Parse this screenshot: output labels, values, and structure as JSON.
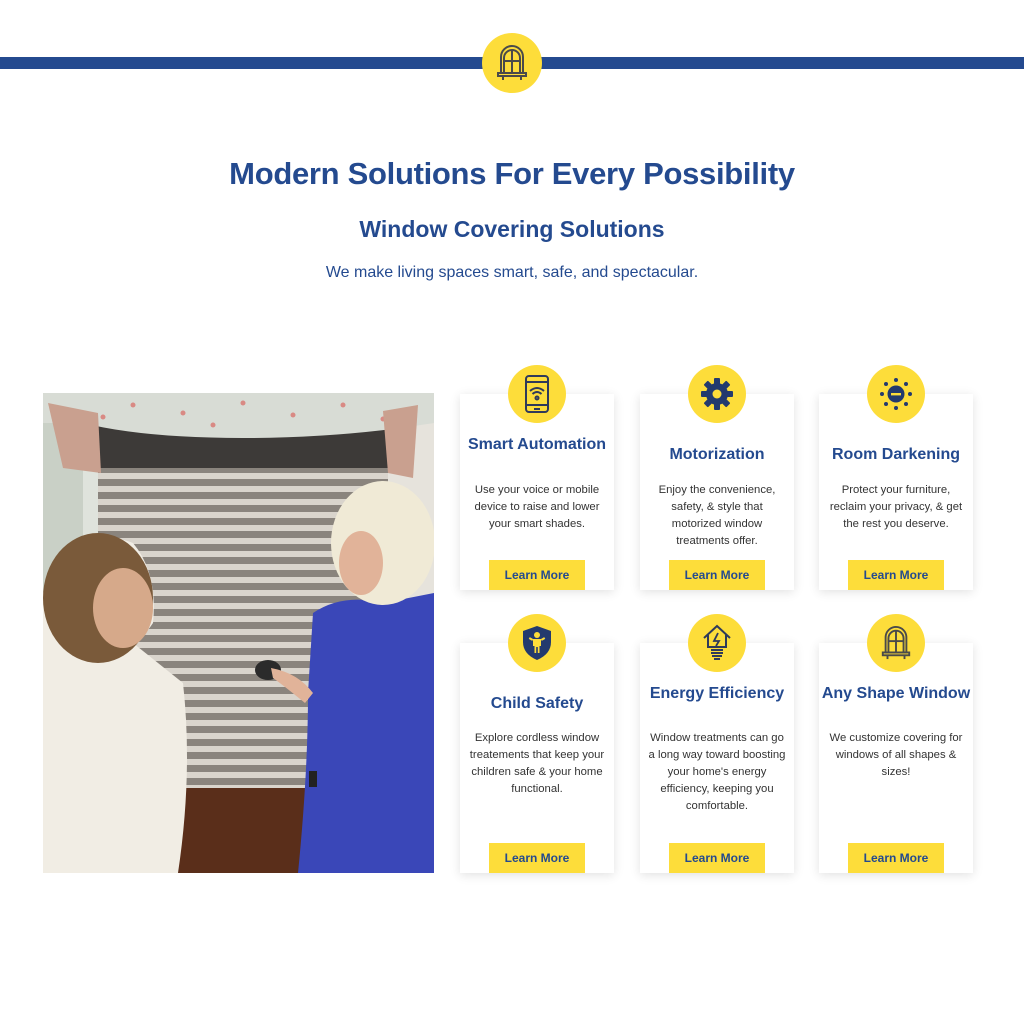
{
  "header": {
    "badge_icon": "arched-window-icon",
    "title": "Modern Solutions For Every Possibility",
    "subtitle": "Window Covering Solutions",
    "tagline": "We make living spaces smart, safe, and spectacular."
  },
  "photo": {
    "alt": "Two women looking at a motorized cellular shade, one holding a remote"
  },
  "colors": {
    "brand_blue": "#244a8f",
    "accent_yellow": "#fddd3a"
  },
  "cards": [
    {
      "icon": "smartphone-wifi-icon",
      "title": "Smart Automation",
      "description": "Use your voice or mobile device to raise and lower your smart shades.",
      "button": "Learn More"
    },
    {
      "icon": "gear-icon",
      "title": "Motorization",
      "description": "Enjoy the convenience, safety, & style that motorized window treatments offer.",
      "button": "Learn More"
    },
    {
      "icon": "sun-darkening-icon",
      "title": "Room Darkening",
      "description": "Protect your furniture, reclaim your privacy, & get the rest you deserve.",
      "button": "Learn More"
    },
    {
      "icon": "child-shield-icon",
      "title": "Child Safety",
      "description": "Explore cordless window treatements that keep your children safe & your home functional.",
      "button": "Learn More"
    },
    {
      "icon": "house-bulb-icon",
      "title": "Energy Efficiency",
      "description": "Window treatments can go a long way toward boosting your home's energy efficiency, keeping you comfortable.",
      "button": "Learn More"
    },
    {
      "icon": "arched-window-icon",
      "title": "Any Shape Window",
      "description": "We customize covering for windows of all shapes & sizes!",
      "button": "Learn More"
    }
  ]
}
